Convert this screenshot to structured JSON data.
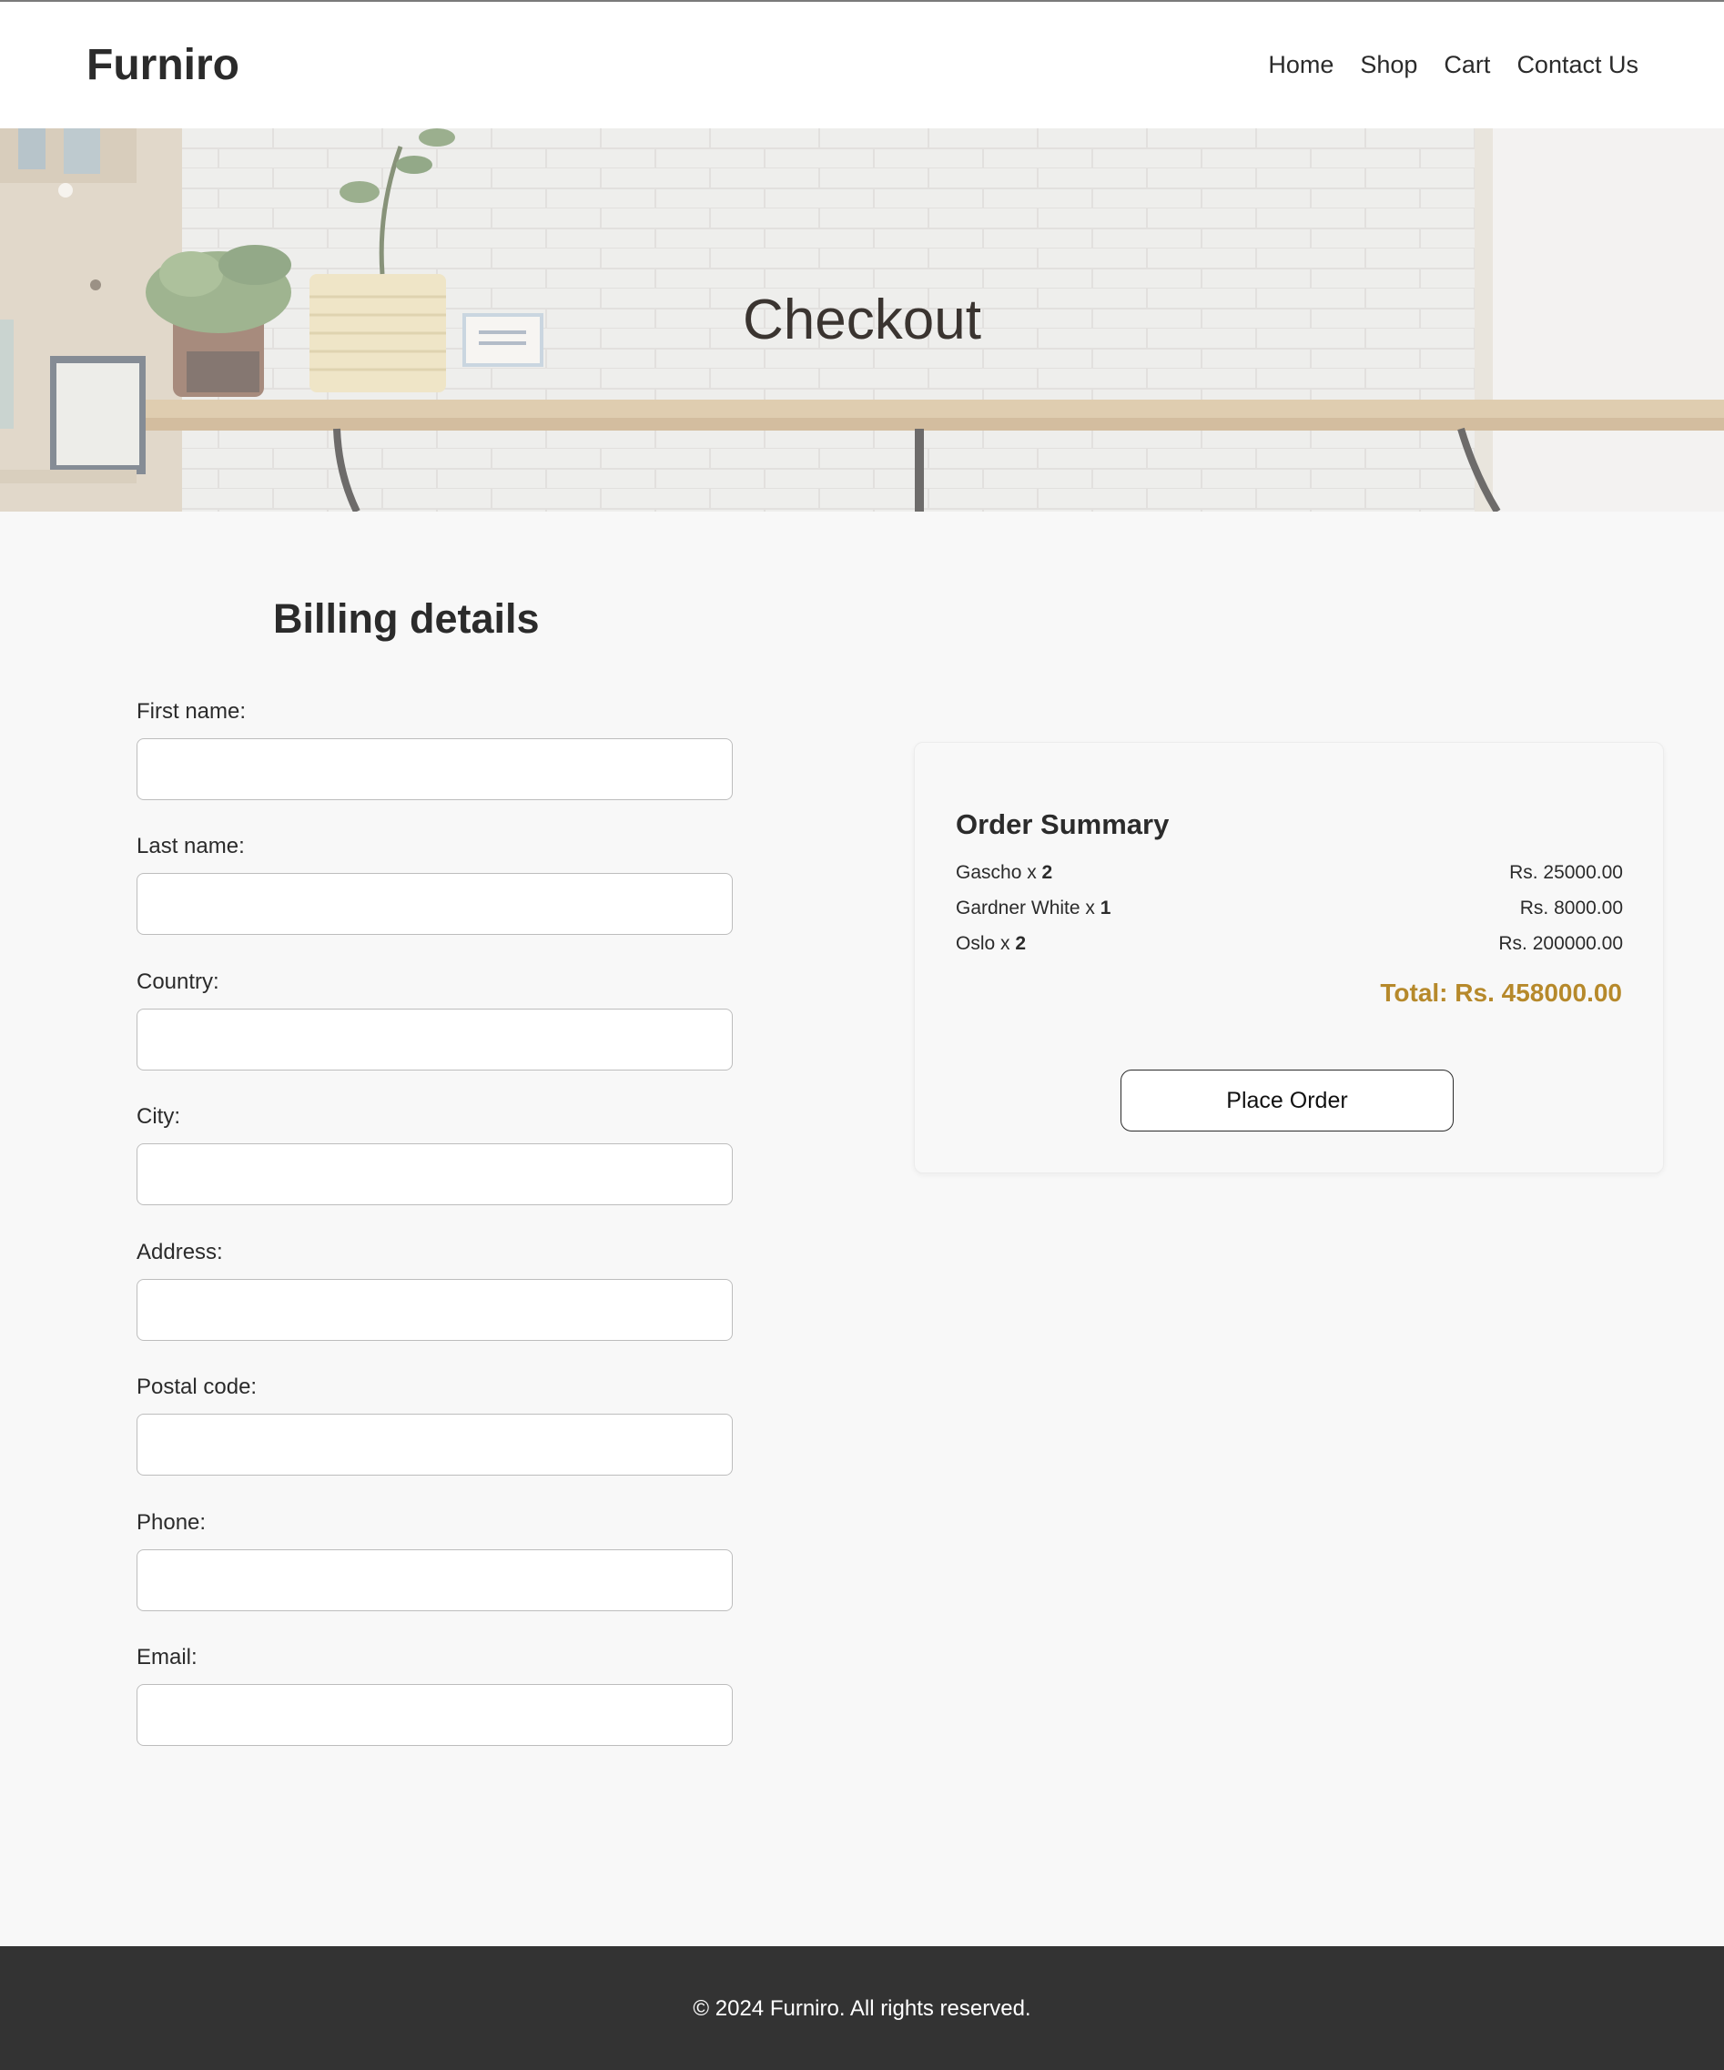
{
  "header": {
    "logo": "Furniro",
    "nav": [
      "Home",
      "Shop",
      "Cart",
      "Contact Us"
    ]
  },
  "hero": {
    "title": "Checkout"
  },
  "billing": {
    "title": "Billing details",
    "fields": [
      {
        "label": "First name:",
        "value": ""
      },
      {
        "label": "Last name:",
        "value": ""
      },
      {
        "label": "Country:",
        "value": ""
      },
      {
        "label": "City:",
        "value": ""
      },
      {
        "label": "Address:",
        "value": ""
      },
      {
        "label": "Postal code:",
        "value": ""
      },
      {
        "label": "Phone:",
        "value": ""
      },
      {
        "label": "Email:",
        "value": ""
      }
    ]
  },
  "summary": {
    "title": "Order Summary",
    "items": [
      {
        "name": "Gascho",
        "sep": " x ",
        "qty": "2",
        "price": "Rs. 25000.00"
      },
      {
        "name": "Gardner White",
        "sep": " x ",
        "qty": "1",
        "price": "Rs. 8000.00"
      },
      {
        "name": "Oslo",
        "sep": " x ",
        "qty": "2",
        "price": "Rs. 200000.00"
      }
    ],
    "total": "Total: Rs. 458000.00",
    "button": "Place Order"
  },
  "footer": {
    "text": "© 2024 Furniro. All rights reserved."
  },
  "colors": {
    "accent_total": "#b6892b",
    "footer_bg": "#333333",
    "page_bg": "#f8f8f8"
  }
}
